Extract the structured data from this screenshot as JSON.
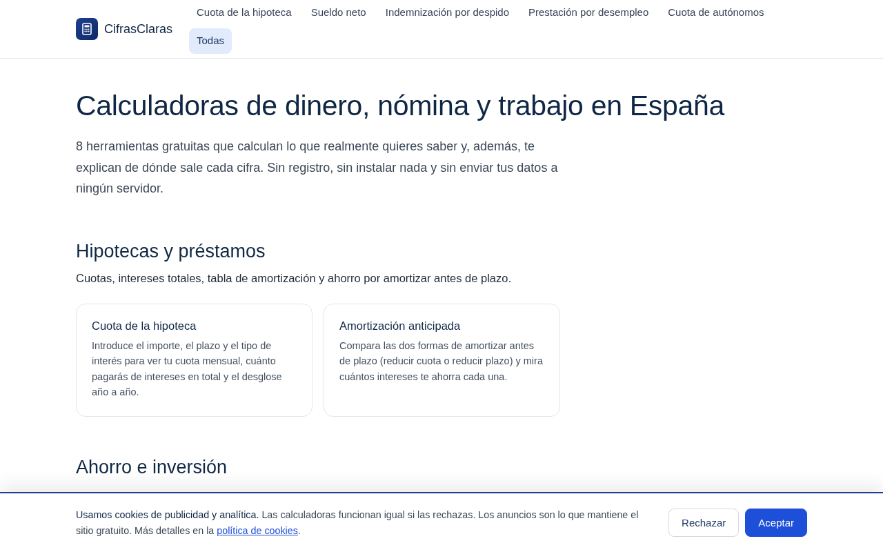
{
  "header": {
    "logo": "CifrasClaras",
    "nav": [
      {
        "label": "Cuota de la hipoteca",
        "selected": false
      },
      {
        "label": "Sueldo neto",
        "selected": false
      },
      {
        "label": "Indemnización por despido",
        "selected": false
      },
      {
        "label": "Prestación por desempleo",
        "selected": false
      },
      {
        "label": "Cuota de autónomos",
        "selected": false
      },
      {
        "label": "Todas",
        "selected": true
      }
    ]
  },
  "hero": {
    "title": "Calculadoras de dinero, nómina y trabajo en España",
    "intro": "8 herramientas gratuitas que calculan lo que realmente quieres saber y, además, te explican de dónde sale cada cifra. Sin registro, sin instalar nada y sin enviar tus datos a ningún servidor."
  },
  "sections": [
    {
      "title": "Hipotecas y préstamos",
      "description": "Cuotas, intereses totales, tabla de amortización y ahorro por amortizar antes de plazo.",
      "cards": [
        {
          "title": "Cuota de la hipoteca",
          "text": "Introduce el importe, el plazo y el tipo de interés para ver tu cuota mensual, cuánto pagarás de intereses en total y el desglose año a año."
        },
        {
          "title": "Amortización anticipada",
          "text": "Compara las dos formas de amortizar antes de plazo (reducir cuota o reducir plazo) y mira cuántos intereses te ahorra cada una."
        }
      ]
    },
    {
      "title": "Ahorro e inversión"
    }
  ],
  "cookie_banner": {
    "text": "**Usamos cookies de publicidad y analítica.** Las calculadoras funcionan igual si las rechazas. Los anuncios son lo que mantiene el sitio gratuito. Más detalles en la",
    "link": "política de cookies",
    "after": ".",
    "buttons": [
      {
        "label": "Rechazar",
        "kind": "secondary"
      },
      {
        "label": "Aceptar",
        "kind": "primary"
      }
    ]
  }
}
